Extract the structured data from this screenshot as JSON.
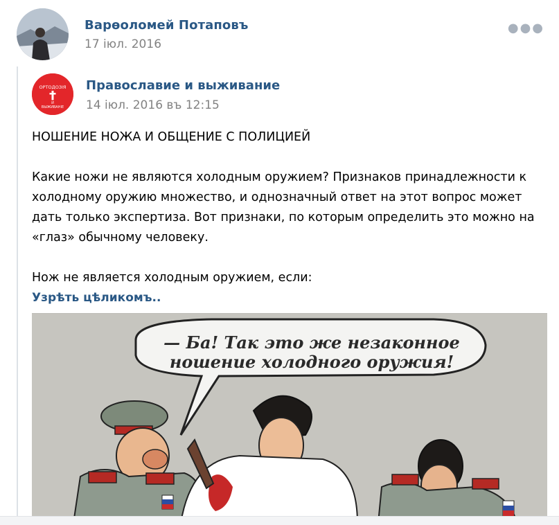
{
  "post": {
    "author_name": "Варѳоломей Потаповъ",
    "date": "17 іюл. 2016",
    "more_icon": "more-horizontal-icon"
  },
  "repost": {
    "group_name": "Православие и выживание",
    "date": "14 іюл. 2016 въ 12:15",
    "group_avatar_text_top": "ОРТОДОЗІЯ",
    "group_avatar_text_mid": "И",
    "group_avatar_text_bottom": "ВЫЖИВАНІЕ",
    "text": {
      "heading": "НОШЕНИЕ НОЖА И ОБЩЕНИЕ С ПОЛИЦИЕЙ",
      "paragraph1": "Какие ножи не являются холодным оружием? Признаков принадлежности к холодному оружию множество, и однозначный ответ на этот вопрос может дать только экспертиза. Вот признаки, по которым определить это можно на «глаз» обычному человеку.",
      "paragraph2": "Нож не является холодным оружием, если:",
      "show_more": "Узрѣть цѣликомъ.."
    },
    "image": {
      "bubble_line1": "— Ба! Так это же незаконное",
      "bubble_line2": "ношение холодного оружия!"
    }
  },
  "colors": {
    "link": "#2a5885",
    "muted": "#828282",
    "group_avatar": "#e3262a"
  }
}
